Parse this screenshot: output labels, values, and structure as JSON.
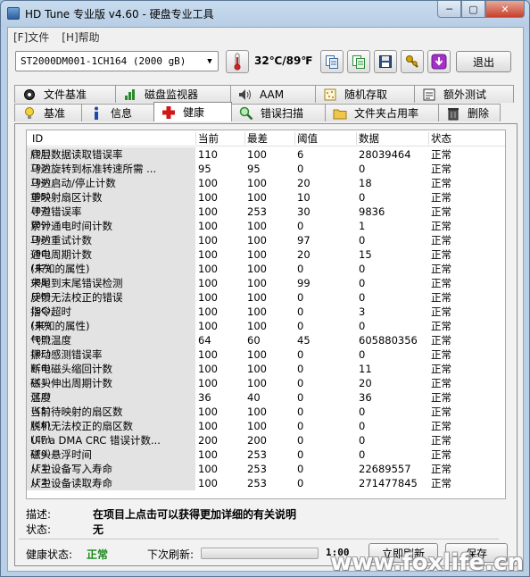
{
  "window": {
    "title": "HD Tune 专业版 v4.60 - 硬盘专业工具",
    "controls": {
      "minimize": "─",
      "maximize": "▢",
      "close": "✕"
    }
  },
  "menu": {
    "items": [
      {
        "label": "[F]文件"
      },
      {
        "label": "[H]帮助"
      }
    ]
  },
  "toolbar": {
    "drive": "ST2000DM001-1CH164   (2000 gB)",
    "temperature": "32℃/89℉",
    "exit_label": "退出"
  },
  "tabs": {
    "row1": [
      {
        "label": "文件基准",
        "icon": "file-benchmark-icon"
      },
      {
        "label": "磁盘监视器",
        "icon": "disk-monitor-icon"
      },
      {
        "label": "AAM",
        "icon": "speaker-icon"
      },
      {
        "label": "随机存取",
        "icon": "random-access-icon"
      },
      {
        "label": "额外测试",
        "icon": "extra-tests-icon"
      }
    ],
    "row2": [
      {
        "label": "基准",
        "icon": "bulb-icon"
      },
      {
        "label": "信息",
        "icon": "info-icon"
      },
      {
        "label": "健康",
        "icon": "health-cross-icon",
        "active": true
      },
      {
        "label": "错误扫描",
        "icon": "magnifier-icon"
      },
      {
        "label": "文件夹占用率",
        "icon": "folder-icon"
      },
      {
        "label": "删除",
        "icon": "trash-icon"
      }
    ]
  },
  "health": {
    "columns": [
      "ID",
      "当前",
      "最差",
      "阈值",
      "数据",
      "状态"
    ],
    "rows": [
      {
        "id": "(01)",
        "name": "底层数据读取错误率",
        "cur": "110",
        "worst": "100",
        "thr": "6",
        "data": "28039464",
        "status": "正常"
      },
      {
        "id": "(03)",
        "name": "马达旋转到标准转速所需 ...",
        "cur": "95",
        "worst": "95",
        "thr": "0",
        "data": "0",
        "status": "正常"
      },
      {
        "id": "(04)",
        "name": "马达启动/停止计数",
        "cur": "100",
        "worst": "100",
        "thr": "20",
        "data": "18",
        "status": "正常"
      },
      {
        "id": "(05)",
        "name": "重映射扇区计数",
        "cur": "100",
        "worst": "100",
        "thr": "10",
        "data": "0",
        "status": "正常"
      },
      {
        "id": "(07)",
        "name": "寻道错误率",
        "cur": "100",
        "worst": "253",
        "thr": "30",
        "data": "9836",
        "status": "正常"
      },
      {
        "id": "(09)",
        "name": "累计通电时间计数",
        "cur": "100",
        "worst": "100",
        "thr": "0",
        "data": "1",
        "status": "正常"
      },
      {
        "id": "(0A)",
        "name": "马达重试计数",
        "cur": "100",
        "worst": "100",
        "thr": "97",
        "data": "0",
        "status": "正常"
      },
      {
        "id": "(0C)",
        "name": "通电周期计数",
        "cur": "100",
        "worst": "100",
        "thr": "20",
        "data": "15",
        "status": "正常"
      },
      {
        "id": "(B7)",
        "name": "(未知的属性)",
        "cur": "100",
        "worst": "100",
        "thr": "0",
        "data": "0",
        "status": "正常"
      },
      {
        "id": "(B8)",
        "name": "末尾到末尾错误检测",
        "cur": "100",
        "worst": "100",
        "thr": "99",
        "data": "0",
        "status": "正常"
      },
      {
        "id": "(BB)",
        "name": "反馈无法校正的错误",
        "cur": "100",
        "worst": "100",
        "thr": "0",
        "data": "0",
        "status": "正常"
      },
      {
        "id": "(BC)",
        "name": "指令超时",
        "cur": "100",
        "worst": "100",
        "thr": "0",
        "data": "3",
        "status": "正常"
      },
      {
        "id": "(BD)",
        "name": "(未知的属性)",
        "cur": "100",
        "worst": "100",
        "thr": "0",
        "data": "0",
        "status": "正常"
      },
      {
        "id": "(BE)",
        "name": "气流温度",
        "cur": "64",
        "worst": "60",
        "thr": "45",
        "data": "605880356",
        "status": "正常"
      },
      {
        "id": "(BF)",
        "name": "振动感测错误率",
        "cur": "100",
        "worst": "100",
        "thr": "0",
        "data": "0",
        "status": "正常"
      },
      {
        "id": "(C0)",
        "name": "断电磁头缩回计数",
        "cur": "100",
        "worst": "100",
        "thr": "0",
        "data": "11",
        "status": "正常"
      },
      {
        "id": "(C1)",
        "name": "磁头伸出周期计数",
        "cur": "100",
        "worst": "100",
        "thr": "0",
        "data": "20",
        "status": "正常"
      },
      {
        "id": "(C2)",
        "name": "温度",
        "cur": "36",
        "worst": "40",
        "thr": "0",
        "data": "36",
        "status": "正常"
      },
      {
        "id": "(C5)",
        "name": "当前待映射的扇区数",
        "cur": "100",
        "worst": "100",
        "thr": "0",
        "data": "0",
        "status": "正常"
      },
      {
        "id": "(C6)",
        "name": "脱机无法校正的扇区数",
        "cur": "100",
        "worst": "100",
        "thr": "0",
        "data": "0",
        "status": "正常"
      },
      {
        "id": "(C7)",
        "name": "Ultra DMA CRC 错误计数...",
        "cur": "200",
        "worst": "200",
        "thr": "0",
        "data": "0",
        "status": "正常"
      },
      {
        "id": "(F0)",
        "name": "磁头悬浮时间",
        "cur": "100",
        "worst": "253",
        "thr": "0",
        "data": "0",
        "status": "正常"
      },
      {
        "id": "(F1)",
        "name": "从主设备写入寿命",
        "cur": "100",
        "worst": "253",
        "thr": "0",
        "data": "22689557",
        "status": "正常"
      },
      {
        "id": "(F2)",
        "name": "从主设备读取寿命",
        "cur": "100",
        "worst": "253",
        "thr": "0",
        "data": "271477845",
        "status": "正常"
      }
    ]
  },
  "details": {
    "desc_label": "描述:",
    "desc_value": "在项目上点击可以获得更加详细的有关说明",
    "state_label": "状态:",
    "state_value": "无"
  },
  "status": {
    "health_label": "健康状态:",
    "health_value": "正常",
    "refresh_label": "下次刷新:",
    "refresh_time": "1:00",
    "refresh_now_label": "立即刷新",
    "save_label": "保存"
  },
  "watermark": "www.foxlife.cn",
  "colors": {
    "ok_green": "#1a8a1a",
    "health_red": "#d01818",
    "aam_purple": "#8a2bd6"
  }
}
